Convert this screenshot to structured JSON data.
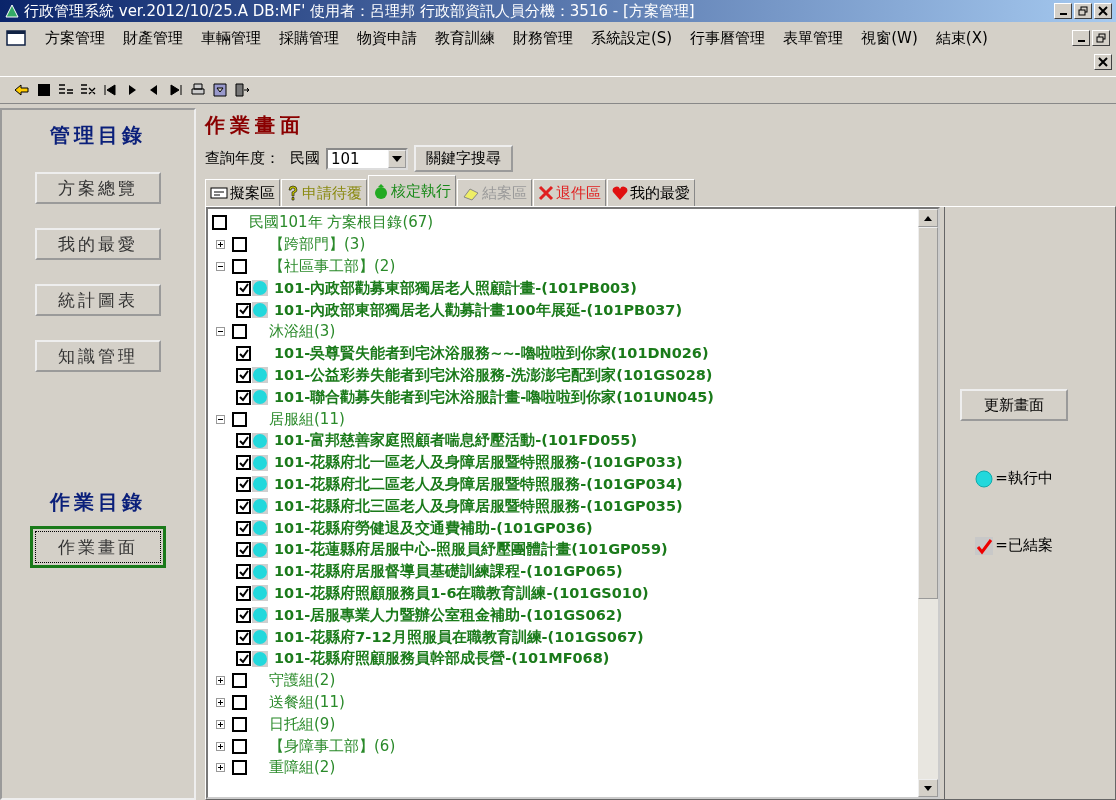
{
  "window": {
    "title": "行政管理系統 ver.2012/10/25.A  DB:MF'  使用者：呂理邦  行政部資訊人員分機：3516 - [方案管理]"
  },
  "menu": [
    "方案管理",
    "財產管理",
    "車輛管理",
    "採購管理",
    "物資申請",
    "教育訓練",
    "財務管理",
    "系統設定(S)",
    "行事曆管理",
    "表單管理",
    "視窗(W)",
    "結束(X)"
  ],
  "sidebar": {
    "sections": [
      {
        "title": "管理目錄",
        "buttons": [
          {
            "label": "方案總覽",
            "selected": false
          },
          {
            "label": "我的最愛",
            "selected": false
          },
          {
            "label": "統計圖表",
            "selected": false
          },
          {
            "label": "知識管理",
            "selected": false
          }
        ]
      },
      {
        "title": "作業目錄",
        "buttons": [
          {
            "label": "作業畫面",
            "selected": true
          }
        ]
      }
    ]
  },
  "main": {
    "title": "作業畫面",
    "year_label": "查詢年度：",
    "era_label": "民國",
    "year": "101",
    "search_button": "關鍵字搜尋",
    "tabs": [
      {
        "label": "擬案區",
        "kind": "draft",
        "selected": false,
        "disabled": false,
        "color": "#000000"
      },
      {
        "label": "申請待覆",
        "kind": "pending",
        "selected": false,
        "disabled": false,
        "color": "#8a8a10"
      },
      {
        "label": "核定執行",
        "kind": "approved",
        "selected": true,
        "disabled": false,
        "color": "#1a8a1a"
      },
      {
        "label": "結案區",
        "kind": "closed",
        "selected": false,
        "disabled": true
      },
      {
        "label": "退件區",
        "kind": "returned",
        "selected": false,
        "disabled": false,
        "color": "#e02020"
      },
      {
        "label": "我的最愛",
        "kind": "favorite",
        "selected": false,
        "disabled": false,
        "color": "#000000"
      }
    ],
    "tree": {
      "label": "民國101年 方案根目錄(67)",
      "checked": false,
      "children": [
        {
          "label": "【跨部門】(3)",
          "checked": false,
          "expanded": false
        },
        {
          "label": "【社區事工部】(2)",
          "checked": false,
          "expanded": true,
          "children": [
            {
              "label": "101-內政部勸募東部獨居老人照顧計畫-(101PB003)",
              "checked": true,
              "running": true
            },
            {
              "label": "101-內政部東部獨居老人勸募計畫100年展延-(101PB037)",
              "checked": true,
              "running": true
            }
          ]
        },
        {
          "label": "沐浴組(3)",
          "checked": false,
          "expanded": true,
          "children": [
            {
              "label": "101-吳尊賢失能者到宅沐浴服務~~-嚕啦啦到你家(101DN026)",
              "checked": true,
              "running": false
            },
            {
              "label": "101-公益彩券失能者到宅沐浴服務-洗澎澎宅配到家(101GS028)",
              "checked": true,
              "running": true
            },
            {
              "label": "101-聯合勸募失能者到宅沐浴服計畫-嚕啦啦到你家(101UN045)",
              "checked": true,
              "running": true
            }
          ]
        },
        {
          "label": "居服組(11)",
          "checked": false,
          "expanded": true,
          "children": [
            {
              "label": "101-富邦慈善家庭照顧者喘息紓壓活動-(101FD055)",
              "checked": true,
              "running": true
            },
            {
              "label": "101-花縣府北一區老人及身障居服暨特照服務-(101GP033)",
              "checked": true,
              "running": true
            },
            {
              "label": "101-花縣府北二區老人及身障居服暨特照服務-(101GP034)",
              "checked": true,
              "running": true
            },
            {
              "label": "101-花縣府北三區老人及身障居服暨特照服務-(101GP035)",
              "checked": true,
              "running": true
            },
            {
              "label": "101-花縣府勞健退及交通費補助-(101GP036)",
              "checked": true,
              "running": true
            },
            {
              "label": "101-花蓮縣府居服中心-照服員紓壓團體計畫(101GP059)",
              "checked": true,
              "running": true
            },
            {
              "label": "101-花縣府居服督導員基礎訓練課程-(101GP065)",
              "checked": true,
              "running": true
            },
            {
              "label": "101-花縣府照顧服務員1-6在職教育訓練-(101GS010)",
              "checked": true,
              "running": true
            },
            {
              "label": "101-居服專業人力暨辦公室租金補助-(101GS062)",
              "checked": true,
              "running": true
            },
            {
              "label": "101-花縣府7-12月照服員在職教育訓練-(101GS067)",
              "checked": true,
              "running": true
            },
            {
              "label": "101-花縣府照顧服務員幹部成長營-(101MF068)",
              "checked": true,
              "running": true
            }
          ]
        },
        {
          "label": "守護組(2)",
          "checked": false,
          "expanded": false
        },
        {
          "label": "送餐組(11)",
          "checked": false,
          "expanded": false
        },
        {
          "label": "日托組(9)",
          "checked": false,
          "expanded": false
        },
        {
          "label": "【身障事工部】(6)",
          "checked": false,
          "expanded": false
        },
        {
          "label": "重障組(2)",
          "checked": false,
          "expanded": false
        }
      ]
    },
    "refresh_button": "更新畫面",
    "legend": [
      {
        "kind": "running",
        "label": "=執行中"
      },
      {
        "kind": "closed",
        "label": "=已結案"
      }
    ]
  }
}
